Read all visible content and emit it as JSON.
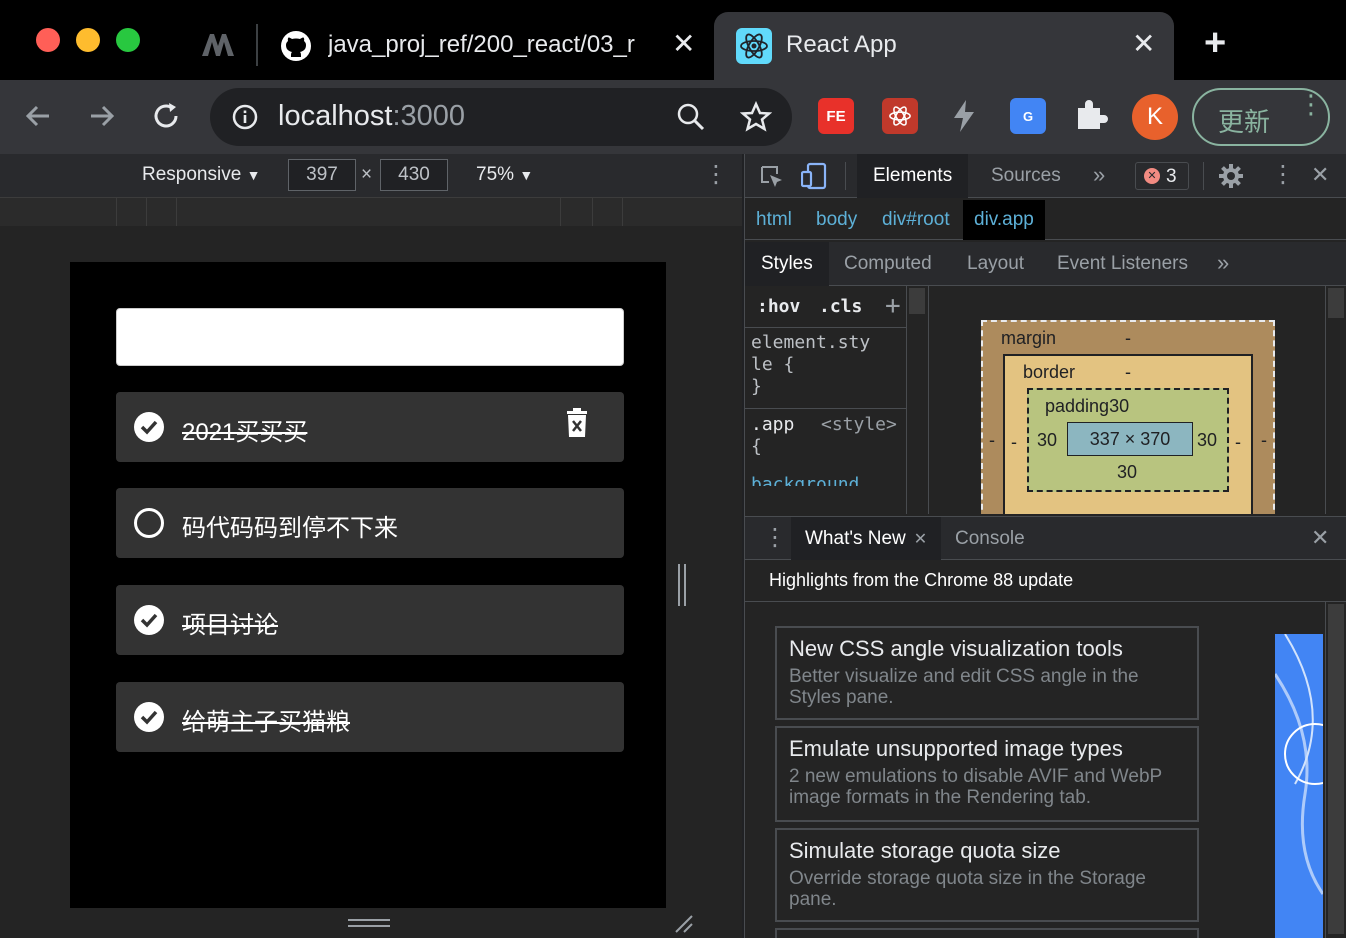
{
  "tabs": [
    {
      "title": "java_proj_ref/200_react/03_r",
      "icon": "github-icon"
    },
    {
      "title": "React App",
      "icon": "react-icon"
    }
  ],
  "address": {
    "host": "localhost",
    "port": ":3000"
  },
  "update_button": "更新",
  "profile_initial": "K",
  "extensions": {
    "fe_label": "FE",
    "translate_label": "G"
  },
  "device": {
    "preset": "Responsive",
    "width": "397",
    "times": "×",
    "height": "430",
    "zoom": "75%"
  },
  "todos": [
    {
      "text": "2021买买买",
      "done": true,
      "strike": true
    },
    {
      "text": "码代码码到停不下来",
      "done": false,
      "strike": false
    },
    {
      "text": "项目讨论",
      "done": true,
      "strike": true
    },
    {
      "text": "给萌主子买猫粮",
      "done": true,
      "strike": true
    }
  ],
  "devtools": {
    "tabs": [
      "Elements",
      "Sources"
    ],
    "error_count": "3",
    "breadcrumbs": [
      "html",
      "body",
      "div#root",
      "div.app"
    ],
    "style_tabs": [
      "Styles",
      "Computed",
      "Layout",
      "Event Listeners"
    ],
    "filter": {
      "hov": ":hov",
      "cls": ".cls",
      "add": "+"
    },
    "rules": {
      "element_style_1": "element.sty",
      "element_style_2": "le {",
      "close_brace": "}",
      "app_selector": ".app",
      "app_source": "<style>",
      "open_brace": "{",
      "prop_peek": "background"
    },
    "box_model": {
      "margin_label": "margin",
      "margin_value": "-",
      "border_label": "border",
      "border_value": "-",
      "padding_label": "padding",
      "padding_top": "30",
      "padding_left": "30",
      "padding_right": "30",
      "padding_bottom": "30",
      "content": "337 × 370",
      "dash": "-"
    },
    "drawer": {
      "tabs": [
        "What's New",
        "Console"
      ],
      "highlights": "Highlights from the Chrome 88 update",
      "cards": [
        {
          "title": "New CSS angle visualization tools",
          "desc": "Better visualize and edit CSS angle in the Styles pane."
        },
        {
          "title": "Emulate unsupported image types",
          "desc": "2 new emulations to disable AVIF and WebP image formats in the Rendering tab."
        },
        {
          "title": "Simulate storage quota size",
          "desc": "Override storage quota size in the Storage pane."
        }
      ]
    }
  },
  "colors": {
    "traffic_red": "#ff5f57",
    "traffic_yellow": "#febc2e",
    "traffic_green": "#28c840",
    "update_green": "#8ab4a0",
    "profile_orange": "#e8612c"
  }
}
